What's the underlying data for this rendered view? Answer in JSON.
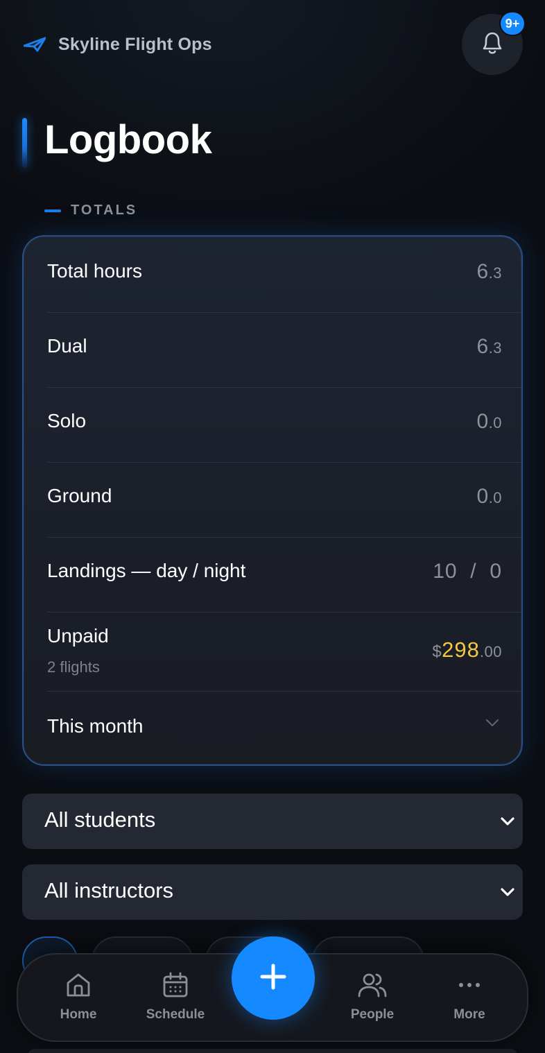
{
  "header": {
    "brand": "Skyline Flight Ops",
    "notifications_badge": "9+"
  },
  "page": {
    "title": "Logbook",
    "section_label": "TOTALS"
  },
  "totals": {
    "total_hours": {
      "label": "Total hours",
      "whole": "6",
      "dec": ".3"
    },
    "dual": {
      "label": "Dual",
      "whole": "6",
      "dec": ".3"
    },
    "solo": {
      "label": "Solo",
      "whole": "0",
      "dec": ".0"
    },
    "ground": {
      "label": "Ground",
      "whole": "0",
      "dec": ".0"
    },
    "landings": {
      "label": "Landings — day / night",
      "day": "10",
      "sep": "/",
      "night": "0"
    },
    "unpaid": {
      "label": "Unpaid",
      "sub": "2 flights",
      "currency": "$",
      "amount": "298",
      "dec": ".00"
    },
    "period": {
      "label": "This month"
    }
  },
  "filters": {
    "students": "All students",
    "instructors": "All instructors"
  },
  "nav": {
    "home": "Home",
    "schedule": "Schedule",
    "people": "People",
    "more": "More"
  },
  "colors": {
    "accent": "#1589ff",
    "money": "#f5c842",
    "background": "#0b0d12",
    "card": "#1d2431"
  }
}
